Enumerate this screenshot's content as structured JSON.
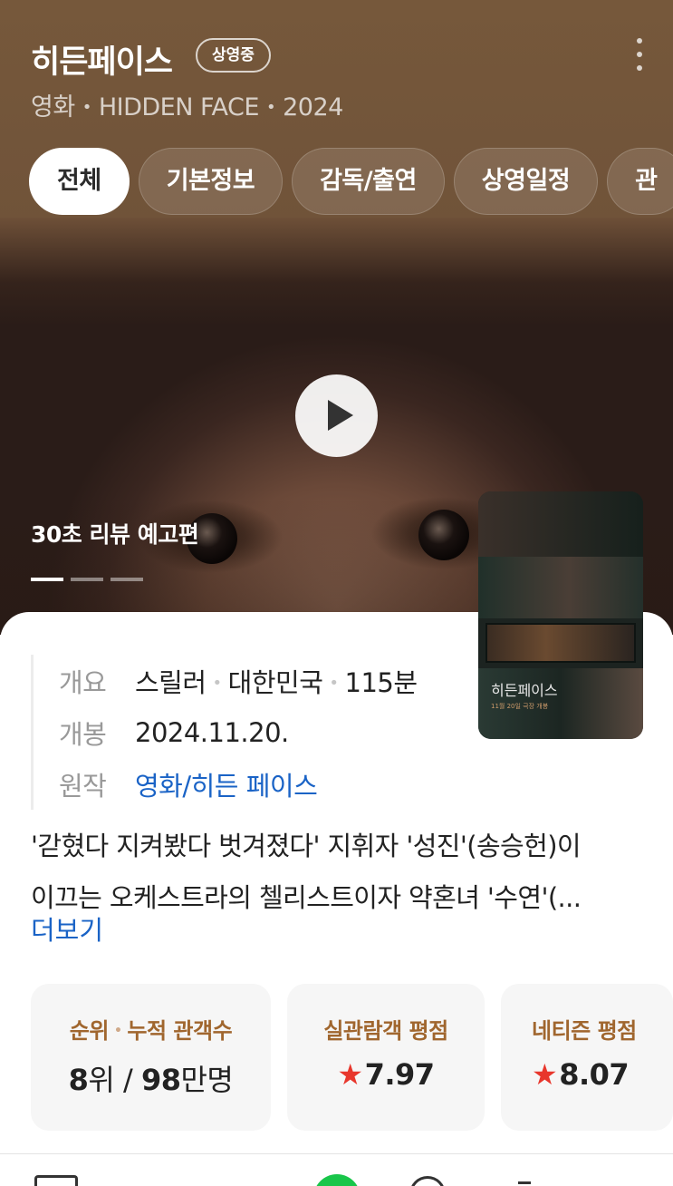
{
  "header": {
    "title": "히든페이스",
    "badge": "상영중",
    "meta": [
      "영화",
      "HIDDEN FACE",
      "2024"
    ]
  },
  "tabs": [
    "전체",
    "기본정보",
    "감독/출연",
    "상영일정",
    "관"
  ],
  "hero": {
    "trailer_label": "30초 리뷰 예고편",
    "indicator_count": 3,
    "active_indicator": 1
  },
  "poster": {
    "title": "히든페이스",
    "date_text": "11월 20일 극장 개봉"
  },
  "info": {
    "overview_label": "개요",
    "overview_items": [
      "스릴러",
      "대한민국",
      "115분"
    ],
    "release_label": "개봉",
    "release_value": "2024.11.20.",
    "original_label": "원작",
    "original_value": "영화/히든 페이스"
  },
  "description": {
    "line1": "'갇혔다 지켜봤다 벗겨졌다' 지휘자 '성진'(송승헌)이",
    "line2": "이끄는 오케스트라의 첼리스트이자 약혼녀 '수연'(...",
    "more": "더보기"
  },
  "stats": {
    "rank_label": "순위",
    "audience_label": "누적 관객수",
    "rank_num": "8",
    "rank_unit": "위",
    "slash": " / ",
    "audience_num": "98",
    "audience_unit": "만명",
    "viewer_rating_label": "실관람객 평점",
    "viewer_rating": "7.97",
    "netizen_rating_label": "네티즌 평점",
    "netizen_rating": "8.07",
    "star": "★"
  },
  "colors": {
    "header_bg": "#76583b",
    "link": "#1a63c6",
    "accent_label": "#a0662e",
    "star": "#e8362c",
    "green": "#19c64a"
  }
}
